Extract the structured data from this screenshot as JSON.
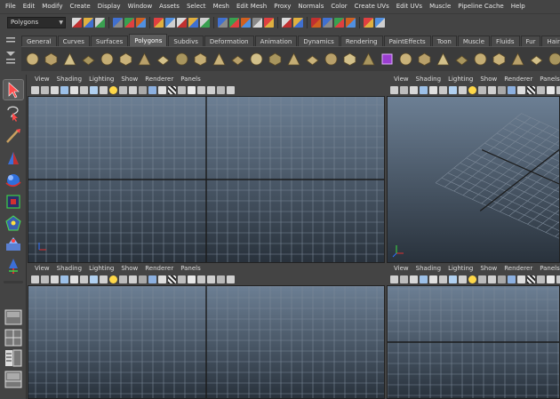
{
  "menubar": [
    "File",
    "Edit",
    "Modify",
    "Create",
    "Display",
    "Window",
    "Assets",
    "Select",
    "Mesh",
    "Edit Mesh",
    "Proxy",
    "Normals",
    "Color",
    "Create UVs",
    "Edit UVs",
    "Muscle",
    "Pipeline Cache",
    "Help"
  ],
  "statusline": {
    "mode": "Polygons",
    "icons": [
      "new-scene-icon",
      "open-scene-icon",
      "save-scene-icon",
      "sep",
      "select-hierarchy-icon",
      "select-object-icon",
      "select-component-icon",
      "sep",
      "snap-grid-icon",
      "snap-curve-icon",
      "snap-point-icon",
      "snap-view-plane-icon",
      "snap-live-icon",
      "sep",
      "history-icon",
      "render-frame-icon",
      "ipr-render-icon",
      "render-settings-icon",
      "hypershade-icon",
      "sep",
      "magnet-icon",
      "magnet-icon-2",
      "sep",
      "render-view-icon",
      "ipr-icon",
      "settings-icon",
      "hypershade-icon-2",
      "sep",
      "lock-icon",
      "lock-icon-2"
    ]
  },
  "shelf": {
    "tabs": [
      "General",
      "Curves",
      "Surfaces",
      "Polygons",
      "Subdivs",
      "Deformation",
      "Animation",
      "Dynamics",
      "Rendering",
      "PaintEffects",
      "Toon",
      "Muscle",
      "Fluids",
      "Fur",
      "Hair"
    ],
    "active_tab": "Polygons",
    "icons": [
      "poly-sphere-icon",
      "poly-cube-icon",
      "poly-cylinder-icon",
      "poly-cone-icon",
      "poly-plane-icon",
      "poly-torus-icon",
      "poly-prism-icon",
      "poly-pyramid-icon",
      "poly-pipe-icon",
      "poly-helix-icon",
      "poly-soccer-icon",
      "combine-icon",
      "separate-icon",
      "extract-icon",
      "booleans-icon",
      "smooth-icon",
      "average-icon",
      "fill-hole-icon",
      "make-hole-icon",
      "cube-purple-icon",
      "extrude-icon",
      "bridge-icon",
      "append-icon",
      "split-icon",
      "insert-loop-icon",
      "offset-loop-icon",
      "bevel-icon",
      "merge-icon",
      "collapse-icon",
      "planar-map-icon",
      "cylindrical-map-icon",
      "spherical-map-icon",
      "auto-map-icon",
      "uv-editor-icon",
      "transfer-icon"
    ]
  },
  "panels": [
    {
      "name": "top-left",
      "menu": [
        "View",
        "Shading",
        "Lighting",
        "Show",
        "Renderer",
        "Panels"
      ]
    },
    {
      "name": "top-right",
      "menu": [
        "View",
        "Shading",
        "Lighting",
        "Show",
        "Renderer",
        "Panels"
      ]
    },
    {
      "name": "bottom-left",
      "menu": [
        "View",
        "Shading",
        "Lighting",
        "Show",
        "Renderer",
        "Panels"
      ]
    },
    {
      "name": "bottom-right",
      "menu": [
        "View",
        "Shading",
        "Lighting",
        "Show",
        "Renderer",
        "Panels"
      ]
    }
  ],
  "colors": {
    "viewport_top": "#6c7f94",
    "viewport_bottom": "#29323c",
    "grid_line": "#7b8897",
    "axis_line": "#1b1b1b",
    "active_tab": "#5d5d5d"
  }
}
